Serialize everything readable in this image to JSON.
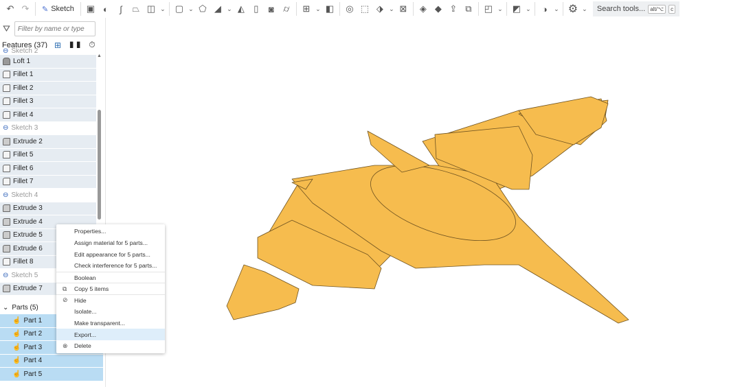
{
  "toolbar": {
    "sketch_label": "Sketch",
    "search_label": "Search tools...",
    "shortcut_1": "alt/⌥",
    "shortcut_2": "c"
  },
  "panel": {
    "filter_placeholder": "Filter by name or type",
    "features_title": "Features (37)",
    "features": [
      {
        "label": "Sketch 2",
        "type": "sketch"
      },
      {
        "label": "Loft 1",
        "type": "loft"
      },
      {
        "label": "Fillet 1",
        "type": "fillet"
      },
      {
        "label": "Fillet 2",
        "type": "fillet"
      },
      {
        "label": "Fillet 3",
        "type": "fillet"
      },
      {
        "label": "Fillet 4",
        "type": "fillet"
      },
      {
        "label": "Sketch 3",
        "type": "sketch"
      },
      {
        "label": "Extrude 2",
        "type": "extrude"
      },
      {
        "label": "Fillet 5",
        "type": "fillet"
      },
      {
        "label": "Fillet 6",
        "type": "fillet"
      },
      {
        "label": "Fillet 7",
        "type": "fillet"
      },
      {
        "label": "Sketch 4",
        "type": "sketch"
      },
      {
        "label": "Extrude 3",
        "type": "extrude"
      },
      {
        "label": "Extrude 4",
        "type": "extrude"
      },
      {
        "label": "Extrude 5",
        "type": "extrude"
      },
      {
        "label": "Extrude 6",
        "type": "extrude"
      },
      {
        "label": "Fillet 8",
        "type": "fillet"
      },
      {
        "label": "Sketch 5",
        "type": "sketch"
      },
      {
        "label": "Extrude 7",
        "type": "extrude"
      }
    ],
    "parts_title": "Parts (5)",
    "parts": [
      "Part 1",
      "Part 2",
      "Part 3",
      "Part 4",
      "Part 5"
    ]
  },
  "menu": {
    "items": [
      {
        "label": "Properties...",
        "icon": ""
      },
      {
        "label": "Assign material for 5 parts...",
        "icon": ""
      },
      {
        "label": "Edit appearance for 5 parts...",
        "icon": ""
      },
      {
        "label": "Check interference for 5 parts...",
        "icon": ""
      },
      {
        "label": "Boolean",
        "icon": "",
        "divider": true
      },
      {
        "label": "Copy 5 items",
        "icon": "copy-icon",
        "divider": true
      },
      {
        "label": "Hide",
        "icon": "hide-icon",
        "divider": true
      },
      {
        "label": "Isolate...",
        "icon": ""
      },
      {
        "label": "Make transparent...",
        "icon": ""
      },
      {
        "label": "Export...",
        "icon": "",
        "highlight": true
      },
      {
        "label": "Delete",
        "icon": "delete-icon"
      }
    ]
  },
  "colors": {
    "model": "#F6BC4E",
    "model_edge": "#7a5a20",
    "selection": "#b9dcf3"
  }
}
